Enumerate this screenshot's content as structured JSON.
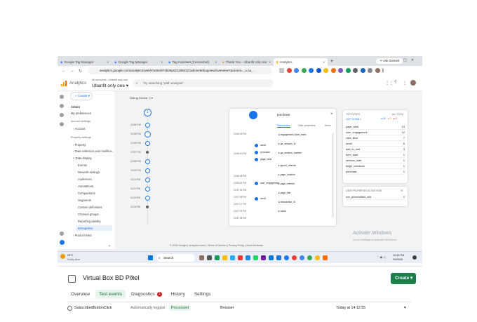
{
  "browser": {
    "tabs": [
      {
        "label": "Google Tag Manager",
        "active": false
      },
      {
        "label": "Google Tag Manager",
        "active": false
      },
      {
        "label": "Tag Assistant (Connected)",
        "active": false
      },
      {
        "label": "Thank You – Ubanfit only one",
        "active": false
      },
      {
        "label": "Analytics",
        "active": true
      }
    ],
    "new_tab": "+",
    "ask_gemini": "Ask Gemini",
    "url": "analytics.google.com/analytics/web/#/a364974626p521186232/admin/debugview/overview?params=_u.na..."
  },
  "analytics": {
    "app_name": "Analytics",
    "all_accounts": "All accounts › Ubanfit only one",
    "property": "Ubanfit only one",
    "search_placeholder": "Try searching \"path analysis\"",
    "create": "Create",
    "sidebar": {
      "admin": "Admin",
      "my_preferences": "My preferences",
      "account_settings": "Account settings",
      "account": "Account",
      "property_settings": "Property settings",
      "property": "Property",
      "data_collection": "Data collection and modifica...",
      "data_display": "Data display",
      "events": "Events",
      "network_settings": "Network settings",
      "audiences": "Audiences",
      "annotations": "Annotations",
      "comparisons": "Comparisons",
      "segments": "Segments",
      "custom_definitions": "Custom definitions",
      "channel_groups": "Channel groups",
      "reporting_identity": "Reporting identity",
      "debugview": "DebugView",
      "product_links": "Product links"
    },
    "debug": {
      "debug_devices": "Debug Device: 1",
      "timeline_times": [
        "10:54 PM",
        "10:55 PM",
        "10:56 PM",
        "10:57 PM",
        "10:58 PM",
        "10:59 PM",
        "11:00 PM",
        "11:01 PM",
        "11:02 PM",
        "11:03 PM"
      ],
      "event_panel_title": "purchase",
      "event_times": [
        "10:56:39 PM",
        "10:56:40 PM",
        "10:56:48 PM",
        "10:56:51 PM",
        "10:57:01 PM",
        "10:57:08 PM",
        "10:57:17 PM",
        "10:57:23 PM",
        "10:57:28 PM"
      ],
      "panel_tabs": [
        "Parameters",
        "User properties",
        "Items"
      ],
      "params": [
        "engagement_time_msec",
        "ga_session_id",
        "ga_session_number",
        "ignore_referrer",
        "page_location",
        "page_referrer",
        "page_title",
        "transaction_id",
        "value"
      ],
      "event_names": [
        "scroll",
        "purchase",
        "page_view",
        "user_engagement",
        "scroll"
      ],
      "top_events_title": "TOP EVENTS",
      "last_30_min": "LAST 30 MIN",
      "all_total": "ALL TOTAL",
      "counts": {
        "blue": "40",
        "orange": "0",
        "red": "0"
      },
      "top_events": [
        {
          "name": "page_view",
          "count": "13"
        },
        {
          "name": "user_engagement",
          "count": "12"
        },
        {
          "name": "view_item",
          "count": "7"
        },
        {
          "name": "scroll",
          "count": "6"
        },
        {
          "name": "add_to_cart",
          "count": "3"
        },
        {
          "name": "form_start",
          "count": "1"
        },
        {
          "name": "session_start",
          "count": "1"
        },
        {
          "name": "begin_checkout",
          "count": "1"
        },
        {
          "name": "purchase",
          "count": "1"
        }
      ],
      "user_props_title": "USER PROPERTIES ACTIVE NOW",
      "user_prop": {
        "name": "non_personalized_ads",
        "value": "0"
      }
    },
    "footer": "© 2026 Google | Analytics home | Terms of Service | Privacy Policy | Send feedback",
    "watermark_title": "Activate Windows",
    "watermark_sub": "Go to Settings to activate Windows."
  },
  "taskbar": {
    "weather_temp": "29°C",
    "weather_desc": "Mostly clear",
    "search": "Search",
    "time": "10:44 PM",
    "date": "3/4/2026"
  },
  "pixel_page": {
    "title": "Virtual Box BD Pixel",
    "create": "Create",
    "tabs": [
      "Overview",
      "Test events",
      "Diagnostics",
      "History",
      "Settings"
    ],
    "diagnostics_badge": "1",
    "event": {
      "name": "SubscribedButtonClick",
      "source": "Automatically logged",
      "status": "Processed",
      "channel": "Browser",
      "time": "Today at 14:12:55"
    }
  },
  "colors": {
    "accent": "#1a73e8",
    "create_green": "#1a7f4b",
    "badge_red": "#c5221f"
  }
}
